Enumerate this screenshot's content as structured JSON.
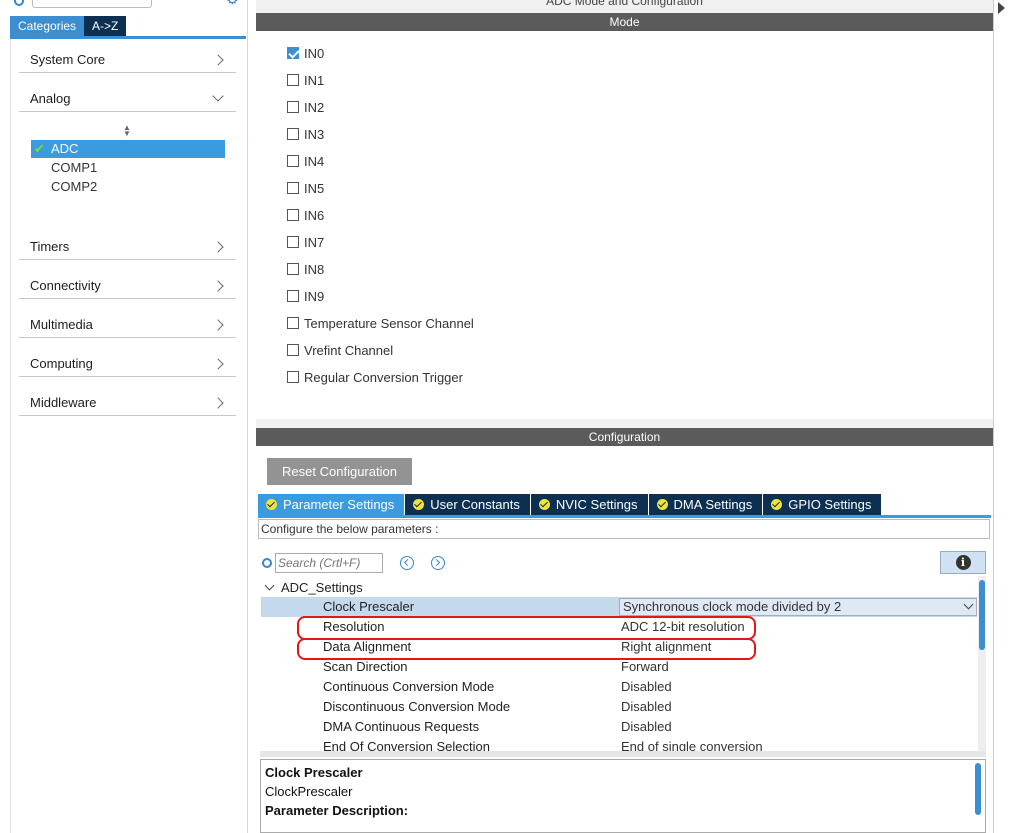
{
  "window_title": "ADC Mode and Configuration",
  "left_panel": {
    "tabs": [
      {
        "label": "Categories",
        "active": true
      },
      {
        "label": "A->Z",
        "active": false
      }
    ],
    "categories": [
      {
        "label": "System Core",
        "expanded": false
      },
      {
        "label": "Analog",
        "expanded": true
      },
      {
        "label": "Timers",
        "expanded": false
      },
      {
        "label": "Connectivity",
        "expanded": false
      },
      {
        "label": "Multimedia",
        "expanded": false
      },
      {
        "label": "Computing",
        "expanded": false
      },
      {
        "label": "Middleware",
        "expanded": false
      }
    ],
    "analog_items": [
      {
        "label": "ADC",
        "selected": true,
        "enabled": true
      },
      {
        "label": "COMP1",
        "selected": false,
        "enabled": false
      },
      {
        "label": "COMP2",
        "selected": false,
        "enabled": false
      }
    ]
  },
  "mode": {
    "header": "Mode",
    "items": [
      {
        "label": "IN0",
        "checked": true
      },
      {
        "label": "IN1",
        "checked": false
      },
      {
        "label": "IN2",
        "checked": false
      },
      {
        "label": "IN3",
        "checked": false
      },
      {
        "label": "IN4",
        "checked": false
      },
      {
        "label": "IN5",
        "checked": false
      },
      {
        "label": "IN6",
        "checked": false
      },
      {
        "label": "IN7",
        "checked": false
      },
      {
        "label": "IN8",
        "checked": false
      },
      {
        "label": "IN9",
        "checked": false
      },
      {
        "label": "Temperature Sensor Channel",
        "checked": false
      },
      {
        "label": "Vrefint Channel",
        "checked": false
      },
      {
        "label": "Regular Conversion Trigger",
        "checked": false
      }
    ]
  },
  "configuration": {
    "header": "Configuration",
    "reset_label": "Reset Configuration",
    "tabs": [
      {
        "label": "Parameter Settings",
        "active": true
      },
      {
        "label": "User Constants",
        "active": false
      },
      {
        "label": "NVIC Settings",
        "active": false
      },
      {
        "label": "DMA Settings",
        "active": false
      },
      {
        "label": "GPIO Settings",
        "active": false
      }
    ],
    "configure_text": "Configure the below parameters :",
    "search_placeholder": "Search (Crtl+F)",
    "group": "ADC_Settings",
    "params": [
      {
        "name": "Clock Prescaler",
        "value": "Synchronous clock mode divided by 2"
      },
      {
        "name": "Resolution",
        "value": "ADC 12-bit resolution"
      },
      {
        "name": "Data Alignment",
        "value": "Right alignment"
      },
      {
        "name": "Scan Direction",
        "value": "Forward"
      },
      {
        "name": "Continuous Conversion Mode",
        "value": "Disabled"
      },
      {
        "name": "Discontinuous Conversion Mode",
        "value": "Disabled"
      },
      {
        "name": "DMA Continuous Requests",
        "value": "Disabled"
      },
      {
        "name": "End Of Conversion Selection",
        "value": "End of single conversion"
      }
    ],
    "description": {
      "title": "Clock Prescaler",
      "identifier": "ClockPrescaler",
      "section_label": "Parameter Description:"
    }
  },
  "colors": {
    "accent": "#3b9be0",
    "dark_tab": "#0c2f52",
    "section_bar": "#5b5b5b",
    "highlight": "#e01818",
    "check_green": "#7bdc2c"
  }
}
